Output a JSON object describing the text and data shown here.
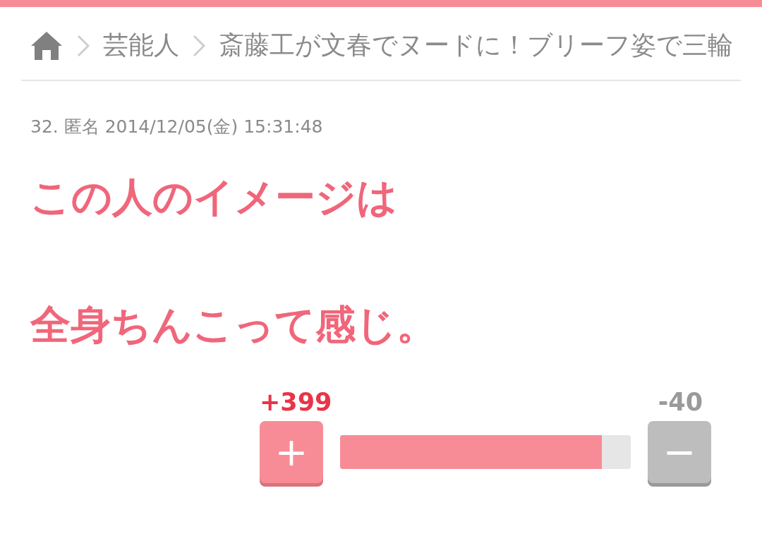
{
  "breadcrumb": {
    "items": [
      "芸能人",
      "斎藤工が文春でヌードに！ブリーフ姿で三輪"
    ]
  },
  "comment": {
    "meta": "32. 匿名 2014/12/05(金) 15:31:48",
    "lines": [
      "この人のイメージは",
      "全身ちんこって感じ。"
    ]
  },
  "votes": {
    "plus": "+399",
    "minus": "-40",
    "plus_button": "+",
    "minus_button": "−",
    "level": 0.9
  }
}
